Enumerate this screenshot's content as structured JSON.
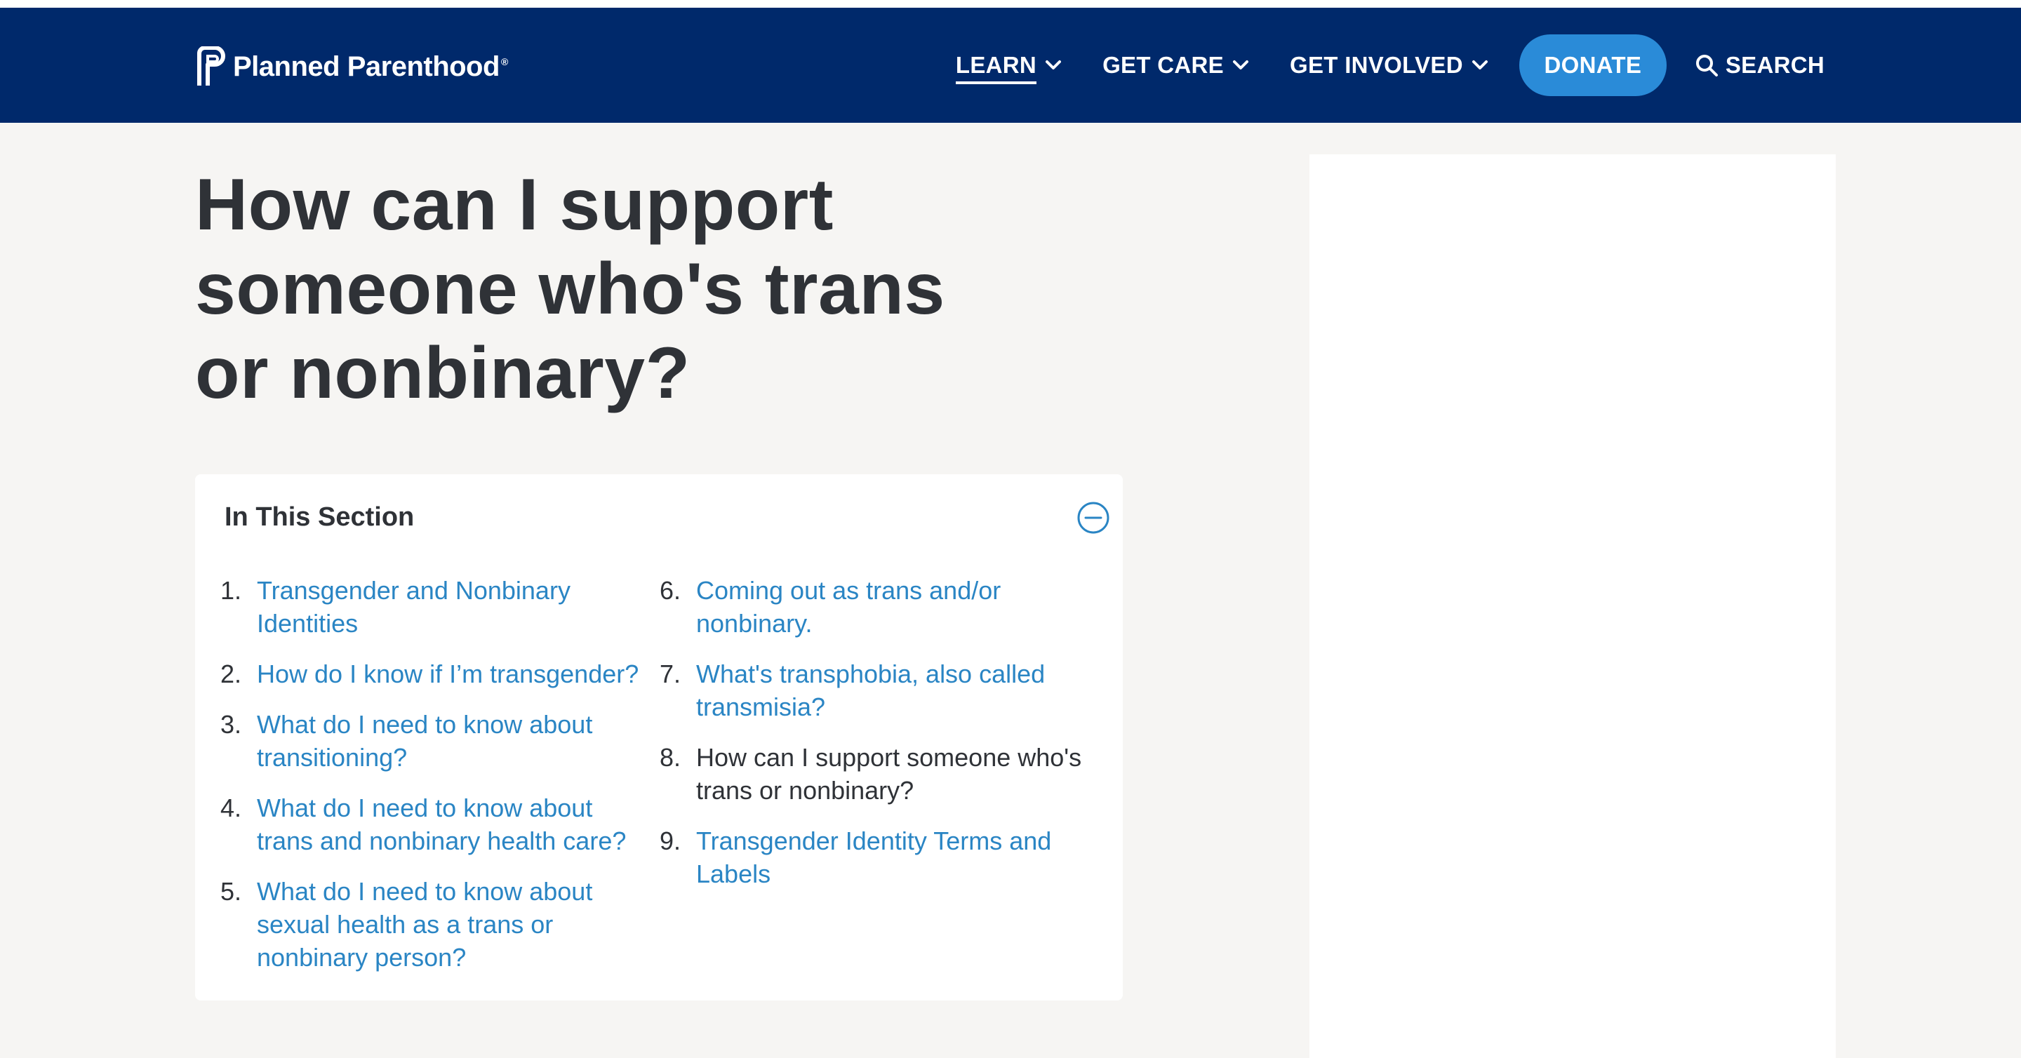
{
  "header": {
    "logo_text": "Planned Parenthood",
    "logo_mark": "®",
    "nav": [
      {
        "label": "LEARN",
        "active": true
      },
      {
        "label": "GET CARE",
        "active": false
      },
      {
        "label": "GET INVOLVED",
        "active": false
      }
    ],
    "donate_label": "DONATE",
    "search_label": "SEARCH",
    "colors": {
      "bar": "#00296b",
      "donate": "#2a8bd8"
    }
  },
  "page": {
    "title": "How can I support someone who's trans or nonbinary?"
  },
  "section": {
    "heading": "In This Section",
    "items": [
      {
        "num": "1.",
        "label": "Transgender and Nonbinary Identities",
        "current": false
      },
      {
        "num": "2.",
        "label": "How do I know if I’m transgender?",
        "current": false
      },
      {
        "num": "3.",
        "label": "What do I need to know about transitioning?",
        "current": false
      },
      {
        "num": "4.",
        "label": "What do I need to know about trans and nonbinary health care?",
        "current": false
      },
      {
        "num": "5.",
        "label": "What do I need to know about sexual health as a trans or nonbinary person?",
        "current": false
      },
      {
        "num": "6.",
        "label": "Coming out as trans and/or nonbinary.",
        "current": false
      },
      {
        "num": "7.",
        "label": "What's transphobia, also called transmisia?",
        "current": false
      },
      {
        "num": "8.",
        "label": "How can I support someone who's trans or nonbinary?",
        "current": true
      },
      {
        "num": "9.",
        "label": "Transgender Identity Terms and Labels",
        "current": false
      }
    ]
  }
}
